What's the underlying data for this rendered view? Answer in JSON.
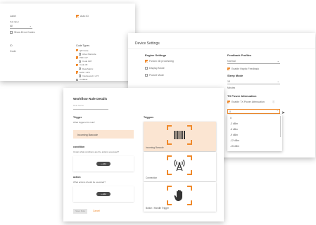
{
  "back_window": {
    "left_col": {
      "label_a": "Label",
      "sublabel_a": "Sub label",
      "select_a": "All",
      "check_a": "Show Error Codes",
      "label_b": "ID",
      "value_b": "Code"
    },
    "right_col": {
      "check_top": "Auto ID",
      "section": "Code Types",
      "items": [
        {
          "label": "QR Code",
          "checked": true
        },
        {
          "label": "Aztec Barcode",
          "checked": false
        },
        {
          "label": "PDF 417",
          "checked": true
        },
        {
          "label": "Code 128",
          "checked": false
        },
        {
          "label": "Code 39",
          "checked": true
        },
        {
          "label": "Data Matrix",
          "checked": false
        },
        {
          "label": "EAN / UPC",
          "checked": true
        },
        {
          "label": "Interleaved 2 of 5",
          "checked": false
        },
        {
          "label": "Codabar",
          "checked": false
        }
      ]
    }
  },
  "device_settings": {
    "title": "Device Settings",
    "engine": {
      "heading": "Engine Settings",
      "items": [
        {
          "label": "Fusion 3D processing",
          "checked": true
        },
        {
          "label": "Display Mode",
          "checked": false
        },
        {
          "label": "Pocket Mode",
          "checked": false
        }
      ]
    },
    "feedback": {
      "heading": "Feedback Profiles",
      "select_value": "Normal",
      "haptic_label": "Enable Haptic Feedback",
      "haptic_checked": true
    },
    "sleep": {
      "heading": "Sleep Mode",
      "select_value": "10",
      "unit": "Minutes"
    },
    "tx": {
      "heading": "TX Power Attenuation",
      "check_label": "Enable TX Power Attenuation",
      "checked": true,
      "info_icon": "info-icon",
      "select_value": "0",
      "options": [
        "0",
        "-3 dBm",
        "-6 dBm",
        "-9 dBm",
        "-12 dBm",
        "-15 dBm"
      ]
    }
  },
  "workflow": {
    "title": "Workflow Rule Details",
    "rule_name_placeholder": "Rule Name",
    "trigger": {
      "heading": "Trigger",
      "question": "What triggers this rule?",
      "selected": "Incoming Barcode"
    },
    "condition": {
      "heading": "condition",
      "question": "Under what conditions are the actions executed?",
      "add_label": "+ Add"
    },
    "action": {
      "heading": "action",
      "question": "What actions should be executed?",
      "add_label": "+ Add"
    },
    "triggers_panel": {
      "heading": "Triggers",
      "items": [
        {
          "caption": "Incoming Barcode",
          "icon": "barcode-icon",
          "selected": true
        },
        {
          "caption": "Connection",
          "icon": "antenna-icon",
          "selected": false
        },
        {
          "caption": "Button / Handle Trigger",
          "icon": "hand-icon",
          "selected": false
        }
      ]
    },
    "save_label": "Save Rule",
    "cancel_label": "Cancel"
  },
  "colors": {
    "accent": "#f0892a",
    "selected_bg": "#fbe5d2"
  }
}
